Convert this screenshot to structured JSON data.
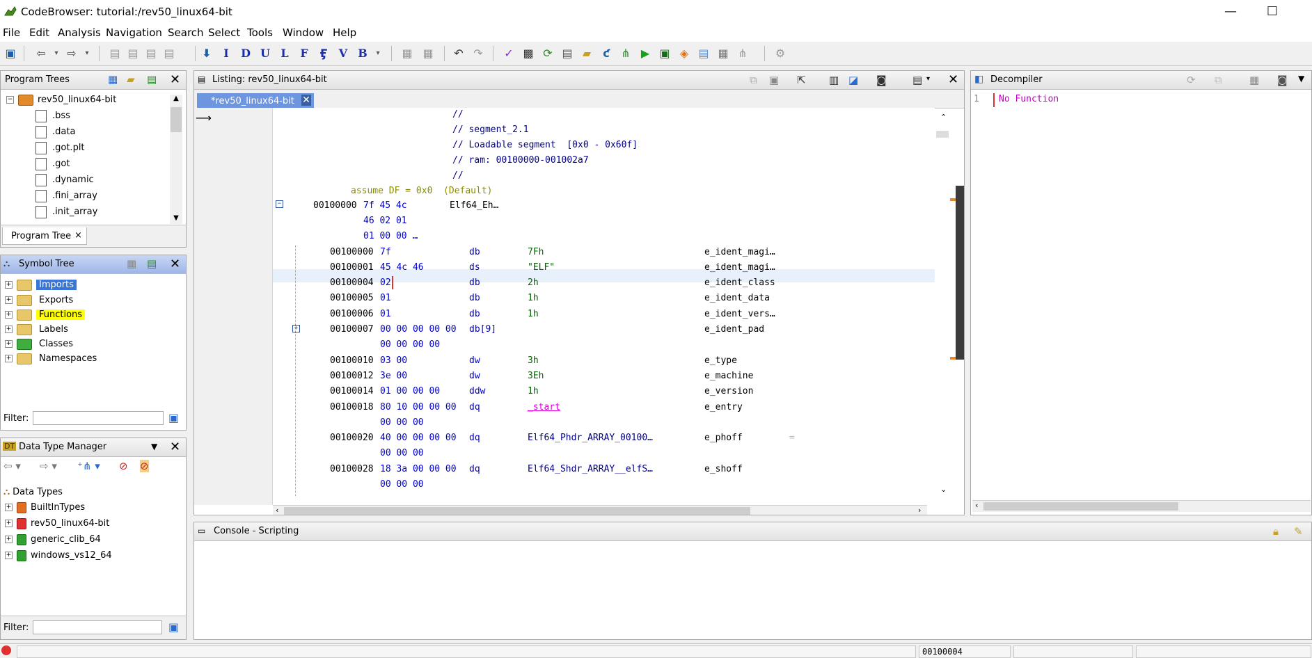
{
  "window": {
    "title": "CodeBrowser: tutorial:/rev50_linux64-bit",
    "minimize": "—",
    "maximize": "☐"
  },
  "menu": [
    "File",
    "Edit",
    "Analysis",
    "Navigation",
    "Search",
    "Select",
    "Tools",
    "Window",
    "Help"
  ],
  "toolbar_letters": [
    "I",
    "D",
    "U",
    "L",
    "F",
    "V",
    "B"
  ],
  "program_trees": {
    "title": "Program Trees",
    "root": "rev50_linux64-bit",
    "items": [
      ".bss",
      ".data",
      ".got.plt",
      ".got",
      ".dynamic",
      ".fini_array",
      ".init_array"
    ],
    "tab": "Program Tree",
    "tab_close": "×"
  },
  "symbol_tree": {
    "title": "Symbol Tree",
    "items": [
      "Imports",
      "Exports",
      "Functions",
      "Labels",
      "Classes",
      "Namespaces"
    ],
    "filter_label": "Filter:"
  },
  "data_type_manager": {
    "title": "Data Type Manager",
    "root": "Data Types",
    "items": [
      "BuiltInTypes",
      "rev50_linux64-bit",
      "generic_clib_64",
      "windows_vs12_64"
    ],
    "filter_label": "Filter:"
  },
  "listing": {
    "title": "Listing:  rev50_linux64-bit",
    "tab": "*rev50_linux64-bit",
    "comments": [
      "//",
      "// segment_2.1",
      "// Loadable segment  [0x0 - 0x60f]",
      "// ram: 00100000-001002a7",
      "//"
    ],
    "assume": "assume DF = 0x0  (Default)",
    "header_addr": "00100000",
    "header_bytes": "7f 45 4c",
    "header_label": "Elf64_Eh…",
    "header_bytes2": "46 02 01",
    "header_bytes3": "01 00 00 …",
    "rows": [
      {
        "addr": "00100000",
        "bytes": "7f",
        "mnem": "db",
        "op": "7Fh",
        "field": "e_ident_magi…"
      },
      {
        "addr": "00100001",
        "bytes": "45 4c 46",
        "mnem": "ds",
        "op": "\"ELF\"",
        "field": "e_ident_magi…"
      },
      {
        "addr": "00100004",
        "bytes": "02",
        "mnem": "db",
        "op": "2h",
        "field": "e_ident_class"
      },
      {
        "addr": "00100005",
        "bytes": "01",
        "mnem": "db",
        "op": "1h",
        "field": "e_ident_data"
      },
      {
        "addr": "00100006",
        "bytes": "01",
        "mnem": "db",
        "op": "1h",
        "field": "e_ident_vers…"
      },
      {
        "addr": "00100007",
        "bytes": "00 00 00 00 00",
        "mnem": "db[9]",
        "op": "",
        "field": "e_ident_pad"
      },
      {
        "addr": "",
        "bytes": "00 00 00 00",
        "mnem": "",
        "op": "",
        "field": ""
      },
      {
        "addr": "00100010",
        "bytes": "03 00",
        "mnem": "dw",
        "op": "3h",
        "field": "e_type"
      },
      {
        "addr": "00100012",
        "bytes": "3e 00",
        "mnem": "dw",
        "op": "3Eh",
        "field": "e_machine"
      },
      {
        "addr": "00100014",
        "bytes": "01 00 00 00",
        "mnem": "ddw",
        "op": "1h",
        "field": "e_version"
      },
      {
        "addr": "00100018",
        "bytes": "80 10 00 00 00",
        "mnem": "dq",
        "op": "_start",
        "field": "e_entry"
      },
      {
        "addr": "",
        "bytes": "00 00 00",
        "mnem": "",
        "op": "",
        "field": ""
      },
      {
        "addr": "00100020",
        "bytes": "40 00 00 00 00",
        "mnem": "dq",
        "op": "Elf64_Phdr_ARRAY_00100…",
        "field": "e_phoff"
      },
      {
        "addr": "",
        "bytes": "00 00 00",
        "mnem": "",
        "op": "",
        "field": ""
      },
      {
        "addr": "00100028",
        "bytes": "18 3a 00 00 00",
        "mnem": "dq",
        "op": "Elf64_Shdr_ARRAY__elfS…",
        "field": "e_shoff"
      },
      {
        "addr": "",
        "bytes": "00 00 00",
        "mnem": "",
        "op": "",
        "field": ""
      }
    ],
    "extra_eq": "="
  },
  "decompiler": {
    "title": "Decompiler",
    "line_no": "1",
    "text": "No Function"
  },
  "console": {
    "title": "Console - Scripting"
  },
  "status": {
    "address": "00100004"
  },
  "colors": {
    "highlight_yellow": "#ffff00",
    "selection_blue": "#3875d7",
    "row_highlight": "#e8f0fb"
  }
}
